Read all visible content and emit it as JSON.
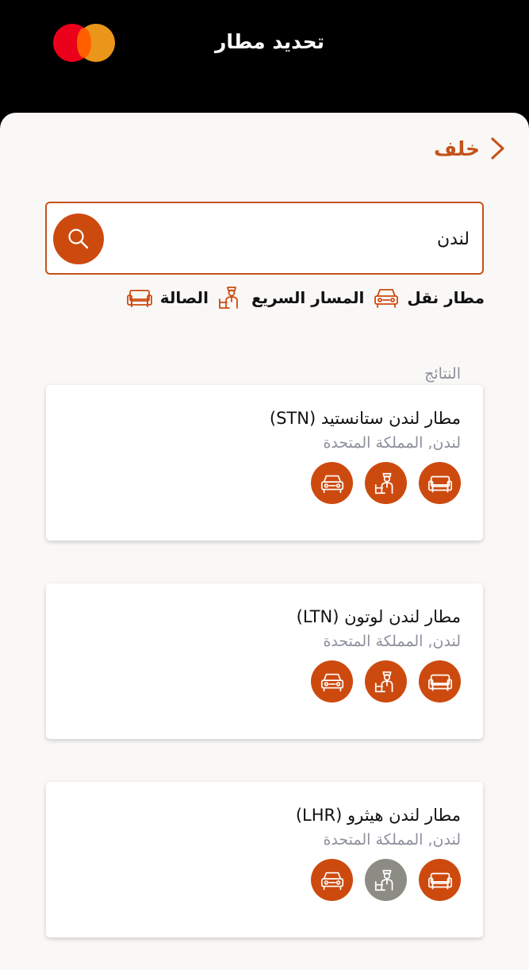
{
  "header": {
    "title": "تحديد مطار"
  },
  "back": {
    "label": "خلف"
  },
  "search": {
    "value": "لندن"
  },
  "legend": [
    {
      "icon": "sofa-icon",
      "label": "الصالة"
    },
    {
      "icon": "fast-track-person-icon",
      "label": "المسار السريع"
    },
    {
      "icon": "car-icon",
      "label": "مطار نقل"
    }
  ],
  "results": {
    "label": "النتائج",
    "items": [
      {
        "name": "مطار لندن ستانستيد (STN)",
        "location": "لندن, المملكة المتحدة",
        "lounge": true,
        "fast_track": true,
        "transfer": true
      },
      {
        "name": "مطار لندن لوتون (LTN)",
        "location": "لندن, المملكة المتحدة",
        "lounge": true,
        "fast_track": true,
        "transfer": true
      },
      {
        "name": "مطار لندن هيثرو (LHR)",
        "location": "لندن, المملكة المتحدة",
        "lounge": true,
        "fast_track": false,
        "transfer": true
      }
    ]
  },
  "colors": {
    "accent": "#cd4a0f",
    "disabled": "#8c8b84",
    "muted_text": "#8d909c"
  }
}
